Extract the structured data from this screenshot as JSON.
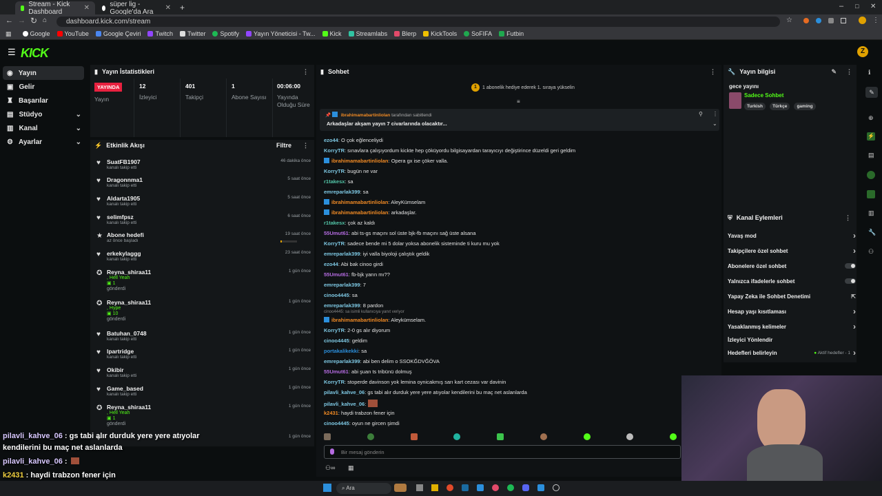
{
  "browser": {
    "tabs": [
      {
        "title": "Stream - Kick Dashboard",
        "active": true
      },
      {
        "title": "süper lig - Google'da Ara",
        "active": false
      }
    ],
    "url": "dashboard.kick.com/stream",
    "bookmarks": [
      "Google",
      "YouTube",
      "Google Çeviri",
      "Twitch",
      "Twitter",
      "Spotify",
      "Yayın Yöneticisi - Tw...",
      "Kick",
      "Streamlabs",
      "Blerp",
      "KickTools",
      "SoFIFA",
      "Futbin"
    ]
  },
  "logo": "KICK",
  "sidebar": {
    "items": [
      {
        "label": "Yayın",
        "icon": "broadcast-icon",
        "active": true
      },
      {
        "label": "Gelir",
        "icon": "money-icon"
      },
      {
        "label": "Başarılar",
        "icon": "trophy-icon"
      },
      {
        "label": "Stüdyo",
        "icon": "studio-icon",
        "expandable": true
      },
      {
        "label": "Kanal",
        "icon": "channel-icon",
        "expandable": true
      },
      {
        "label": "Ayarlar",
        "icon": "gear-icon",
        "expandable": true
      }
    ]
  },
  "stats": {
    "title": "Yayın İstatistikleri",
    "live_badge": "YAYINDA",
    "live_label": "Yayın",
    "viewers": {
      "value": "12",
      "label": "İzleyici"
    },
    "followers": {
      "value": "401",
      "label": "Takipçi"
    },
    "subs": {
      "value": "1",
      "label": "Abone Sayısı"
    },
    "duration": {
      "value": "00:06:00",
      "label": "Yayında Olduğu Süre"
    }
  },
  "activity": {
    "title": "Etkinlik Akışı",
    "filter": "Filtre",
    "events": [
      {
        "name": "SuatFB1907",
        "sub": "kanalı takip etti",
        "time": "46 dakika önce",
        "icon": "heart-icon"
      },
      {
        "name": "Dragonnma1",
        "sub": "kanalı takip etti",
        "time": "5 saat önce",
        "icon": "heart-icon"
      },
      {
        "name": "Aldarta1905",
        "sub": "kanalı takip etti",
        "time": "5 saat önce",
        "icon": "heart-icon"
      },
      {
        "name": "selimfpsz",
        "sub": "kanalı takip etti",
        "time": "6 saat önce",
        "icon": "heart-icon"
      },
      {
        "name": "Abone hedefi",
        "sub": "az önce başladı",
        "time": "19 saat önce",
        "icon": "star-icon"
      },
      {
        "name": "erkekylaggg",
        "sub": "kanalı takip etti",
        "time": "23 saat önce",
        "icon": "heart-icon"
      },
      {
        "name": "Reyna_shiraa11",
        "gift1": ", Hell Yeah",
        "gift2": "1",
        "gift3": "gönderdi",
        "time": "1 gün önce",
        "icon": "gift-icon"
      },
      {
        "name": "Reyna_shiraa11",
        "gift1": ", Hype",
        "gift2": "10",
        "gift3": "gönderdi",
        "time": "1 gün önce",
        "icon": "gift-icon"
      },
      {
        "name": "Batuhan_0748",
        "sub": "kanalı takip etti",
        "time": "1 gün önce",
        "icon": "heart-icon"
      },
      {
        "name": "lpartridge",
        "sub": "kanalı takip etti",
        "time": "1 gün önce",
        "icon": "heart-icon"
      },
      {
        "name": "Okibir",
        "sub": "kanalı takip etti",
        "time": "1 gün önce",
        "icon": "heart-icon"
      },
      {
        "name": "Game_based",
        "sub": "kanalı takip etti",
        "time": "1 gün önce",
        "icon": "heart-icon"
      },
      {
        "name": "Reyna_shiraa11",
        "gift1": ", Hell Yeah",
        "gift2": "1",
        "gift3": "gönderdi",
        "time": "1 gün önce",
        "icon": "gift-icon"
      },
      {
        "name": "",
        "sub": "",
        "time": "1 gün önce",
        "icon": "heart-icon"
      }
    ]
  },
  "chat": {
    "title": "Sohbet",
    "banner": "1 abonelik hediye ederek 1. sıraya yükselin",
    "pinned_by": "ibrahimamabartinliolan",
    "pinned_by_suffix": "tarafından sabitlendi",
    "pinned_text": "Arkadaşlar akşam yayın 7 civarlarında olacaktır...",
    "input_placeholder": "Bir mesaj gönderin",
    "messages": [
      {
        "user": "ezo44",
        "text": ": O çok eğlenceliydi",
        "color": "#7ec8e3"
      },
      {
        "user": "KorryTR",
        "text": ": sınavlara çalışıyordum kickte hep çöküyordu bilgisayardan tarayıcıyı değiştirince düzeldi geri geldim",
        "color": "#7ec8e3"
      },
      {
        "user": "ibrahimamabartinliolan",
        "text": ": Opera gx ise çöker valla.",
        "color": "#f08a24",
        "badge": true
      },
      {
        "user": "KorryTR",
        "text": ": bugün ne var",
        "color": "#7ec8e3"
      },
      {
        "user": "r1takesx",
        "text": ": sa",
        "color": "#53c6a8"
      },
      {
        "user": "emreparlak399",
        "text": ": sa",
        "color": "#7ec8e3"
      },
      {
        "user": "ibrahimamabartinliolan",
        "text": ": AleyKümselam",
        "color": "#f08a24",
        "badge": true
      },
      {
        "user": "ibrahimamabartinliolan",
        "text": ": arkadaşlar.",
        "color": "#f08a24",
        "badge": true
      },
      {
        "user": "r1takesx",
        "text": ": çok az kaldı",
        "color": "#53c6a8"
      },
      {
        "user": "55Umut61",
        "text": ": abi ts-gs maçını sol üste bjk-fb maçını sağ üste alsana",
        "color": "#b46be0"
      },
      {
        "user": "KorryTR",
        "text": ": sadece bende mi 5 dolar yoksa abonelik sisteminde ti kuru mu yok",
        "color": "#7ec8e3"
      },
      {
        "user": "emreparlak399",
        "text": ": iyi valla biyoloji çalıştık geldik",
        "color": "#7ec8e3"
      },
      {
        "user": "ezo44",
        "text": ": Abi bak cinoo girdi",
        "color": "#7ec8e3"
      },
      {
        "user": "55Umut61",
        "text": ": fb-bjk yarın mı??",
        "color": "#b46be0"
      },
      {
        "user": "emreparlak399",
        "text": ": 7",
        "color": "#7ec8e3"
      },
      {
        "user": "cinoo4445",
        "text": ": sa",
        "color": "#7ec8e3"
      },
      {
        "user": "emreparlak399",
        "text": ": 8 pardon",
        "color": "#7ec8e3"
      },
      {
        "user": "ibrahimamabartinliolan",
        "text": ": Aleykümselam.",
        "color": "#f08a24",
        "badge": true,
        "reply": "cinoo4445: sa isimli kullanıcıya yanıt veriyor"
      },
      {
        "user": "KorryTR",
        "text": ": 2-0 gs alır diyorum",
        "color": "#7ec8e3"
      },
      {
        "user": "cinoo4445",
        "text": ": geldim",
        "color": "#7ec8e3"
      },
      {
        "user": "portakalikekki",
        "text": ": sa",
        "color": "#2b8fdc"
      },
      {
        "user": "emreparlak399",
        "text": ": abi ben delim o SSOKĞDVĞÖVA",
        "color": "#7ec8e3"
      },
      {
        "user": "55Umut61",
        "text": ": abi şuan ts tribünü dolmuş",
        "color": "#b46be0"
      },
      {
        "user": "KorryTR",
        "text": ": stoperde davinson yok lemina oynicakmış sarı kart cezası var davinin",
        "color": "#7ec8e3"
      },
      {
        "user": "pilavli_kahve_06",
        "text": ": gs tabi alır durduk yere yere atıyolar kendilerini bu maç net aslanlarda",
        "color": "#7ec8e3"
      },
      {
        "user": "pilavli_kahve_06",
        "text": ":",
        "color": "#7ec8e3"
      },
      {
        "user": "k2431",
        "text": ": haydi trabzon fener için",
        "color": "#f08a24"
      },
      {
        "user": "cinoo4445",
        "text": ": oyun ne gircen şimdi",
        "color": "#7ec8e3"
      }
    ]
  },
  "stream_info": {
    "title": "Yayın bilgisi",
    "stream_title": "gece yayını",
    "category": "Sadece Sohbet",
    "tags": [
      "Turkish",
      "Türkçe",
      "gaming"
    ]
  },
  "channel_actions": {
    "title": "Kanal Eylemleri",
    "items": [
      {
        "label": "Yavaş mod",
        "control": "chevron"
      },
      {
        "label": "Takipçilere özel sohbet",
        "control": "chevron"
      },
      {
        "label": "Abonelere özel sohbet",
        "control": "toggle"
      },
      {
        "label": "Yalnızca ifadelerle sohbet",
        "control": "toggle"
      },
      {
        "label": "Yapay Zeka ile Sohbet Denetimi",
        "control": "external"
      },
      {
        "label": "Hesap yaşı kısıtlaması",
        "control": "chevron"
      },
      {
        "label": "Yasaklanmış kelimeler",
        "control": "chevron"
      },
      {
        "label": "İzleyici Yönlendir",
        "control": "none"
      },
      {
        "label": "Hedefleri belirleyin",
        "control": "chevron",
        "status": "Aktif hedefler - 1"
      }
    ]
  },
  "overlay": {
    "lines": [
      {
        "user": "pilavli_kahve_06",
        "text": " : gs tabi alır durduk yere yere atıyolar"
      },
      {
        "user": "",
        "text": "kendilerini bu maç net aslanlarda"
      },
      {
        "user": "pilavli_kahve_06",
        "text": " :"
      },
      {
        "user": "k2431",
        "text": " : haydi trabzon fener için"
      },
      {
        "user": "cinoo4445",
        "text": " : oyun ne gircen şimdi"
      }
    ]
  },
  "taskbar": {
    "search": "Ara"
  },
  "colors": {
    "accent": "#53fc18",
    "live": "#e8213f",
    "bg": "#0b0e0f",
    "panel": "#141719"
  }
}
